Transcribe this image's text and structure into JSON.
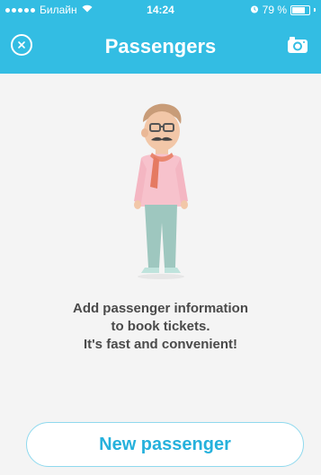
{
  "status_bar": {
    "carrier": "Билайн",
    "time": "14:24",
    "battery_percent": "79 %",
    "battery_level": 0.79
  },
  "header": {
    "title": "Passengers",
    "close_icon": "close-icon",
    "camera_icon": "camera-icon",
    "background_color": "#33bde3"
  },
  "empty_state": {
    "illustration": "man-with-scarf-illustration",
    "line1": "Add passenger information",
    "line2": "to book tickets.",
    "line3": "It's fast and convenient!"
  },
  "actions": {
    "new_passenger_label": "New passenger"
  }
}
